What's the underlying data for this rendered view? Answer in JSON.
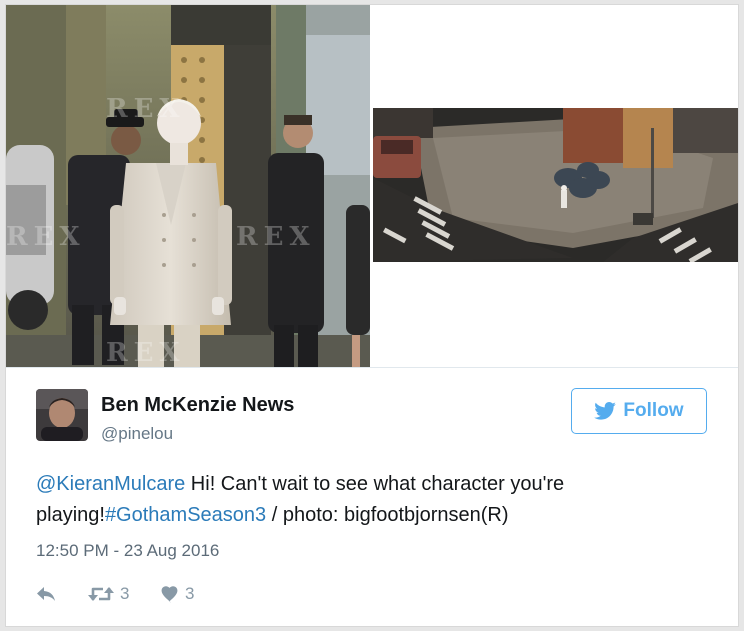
{
  "media": {
    "watermark": "REX"
  },
  "author": {
    "name": "Ben McKenzie News",
    "handle": "@pinelou"
  },
  "follow_button": {
    "label": "Follow"
  },
  "tweet": {
    "mention": "@KieranMulcare",
    "text_part1": " Hi! Can't wait to see what character you're playing!",
    "hashtag": "#GothamSeason3",
    "text_part2": " / photo: bigfootbjornsen(R)"
  },
  "timestamp": "12:50 PM - 23 Aug 2016",
  "actions": {
    "retweet_count": "3",
    "like_count": "3"
  },
  "colors": {
    "link": "#2b7bb9",
    "follow": "#55acee",
    "action_gray": "#8899a6",
    "text": "#14171a",
    "secondary": "#657786"
  },
  "icons": {
    "follow": "twitter-bird-icon",
    "reply": "reply-icon",
    "retweet": "retweet-icon",
    "like": "heart-icon"
  }
}
